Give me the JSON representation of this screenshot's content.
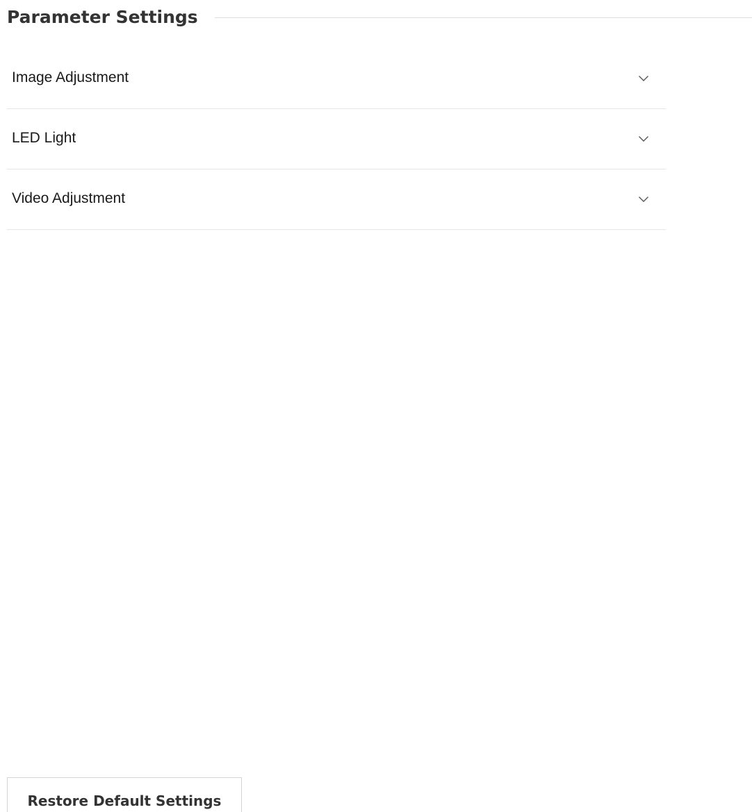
{
  "header": {
    "title": "Parameter Settings"
  },
  "accordion": {
    "items": [
      {
        "label": "Image Adjustment",
        "icon": "chevron-down-icon",
        "expanded": false
      },
      {
        "label": "LED Light",
        "icon": "chevron-down-icon",
        "expanded": false
      },
      {
        "label": "Video Adjustment",
        "icon": "chevron-down-icon",
        "expanded": false
      }
    ]
  },
  "footer": {
    "restore_label": "Restore Default Settings"
  },
  "colors": {
    "title": "#333333",
    "divider": "#e5e5e5",
    "button_border": "#d4d4d4"
  }
}
